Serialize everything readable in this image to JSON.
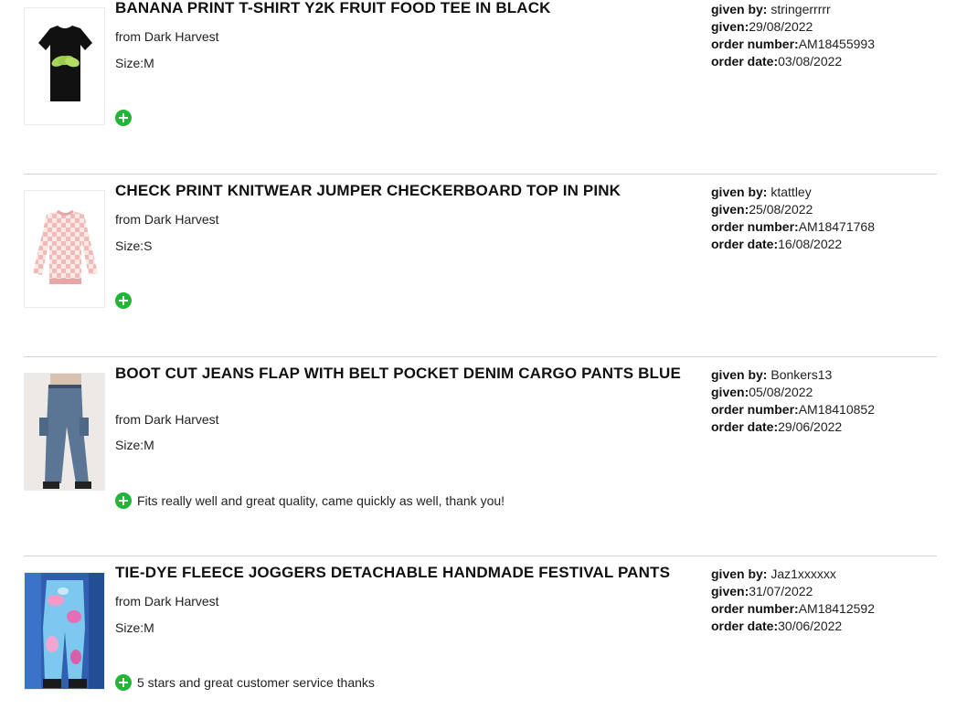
{
  "items": [
    {
      "title": "BANANA PRINT T-SHIRT Y2K FRUIT FOOD TEE IN BLACK",
      "from": "from Dark Harvest",
      "size": "Size:M",
      "given_by_label": "given by:",
      "given_by": "stringerrrrr",
      "given_label": "given:",
      "given": "29/08/2022",
      "order_number_label": "order number:",
      "order_number": "AM18455993",
      "order_date_label": "order date:",
      "order_date": "03/08/2022",
      "review": "",
      "image": "black-tshirt-banana-print"
    },
    {
      "title": "CHECK PRINT KNITWEAR JUMPER CHECKERBOARD TOP IN PINK",
      "from": "from Dark Harvest",
      "size": "Size:S",
      "given_by_label": "given by:",
      "given_by": "ktattley",
      "given_label": "given:",
      "given": "25/08/2022",
      "order_number_label": "order number:",
      "order_number": "AM18471768",
      "order_date_label": "order date:",
      "order_date": "16/08/2022",
      "review": "",
      "image": "pink-checkerboard-jumper"
    },
    {
      "title": "BOOT CUT JEANS FLAP WITH BELT POCKET DENIM CARGO PANTS BLUE",
      "from": "from Dark Harvest",
      "size": "Size:M",
      "given_by_label": "given by:",
      "given_by": "Bonkers13",
      "given_label": "given:",
      "given": "05/08/2022",
      "order_number_label": "order number:",
      "order_number": "AM18410852",
      "order_date_label": "order date:",
      "order_date": "29/06/2022",
      "review": "Fits really well and great quality, came quickly as well, thank you!",
      "image": "blue-denim-cargo-jeans"
    },
    {
      "title": "TIE-DYE FLEECE JOGGERS DETACHABLE HANDMADE FESTIVAL PANTS",
      "from": "from Dark Harvest",
      "size": "Size:M",
      "given_by_label": "given by:",
      "given_by": "Jaz1xxxxxx",
      "given_label": "given:",
      "given": "31/07/2022",
      "order_number_label": "order number:",
      "order_number": "AM18412592",
      "order_date_label": "order date:",
      "order_date": "30/06/2022",
      "review": "5 stars and great customer service thanks",
      "image": "tie-dye-fleece-joggers"
    }
  ],
  "colors": {
    "accent_green": "#22b537",
    "divider": "#d4d4d4"
  }
}
